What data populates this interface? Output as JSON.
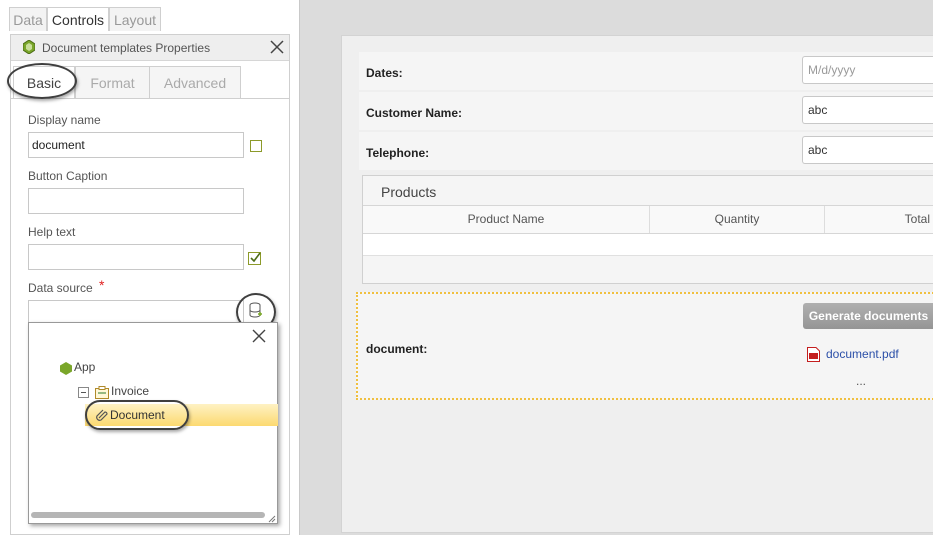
{
  "left_tabs": [
    "Data",
    "Controls",
    "Layout"
  ],
  "properties": {
    "title": "Document templates Properties",
    "sub_tabs": [
      "Basic",
      "Format",
      "Advanced"
    ],
    "display_name_label": "Display name",
    "display_name_value": "document",
    "button_caption_label": "Button Caption",
    "button_caption_value": "",
    "help_text_label": "Help text",
    "help_text_value": "",
    "data_source_label": "Data source",
    "required_mark": "*",
    "data_source_value": ""
  },
  "tree": {
    "root": "App",
    "child": "Invoice",
    "selected": "Document"
  },
  "form": {
    "dates_label": "Dates:",
    "dates_placeholder": "M/d/yyyy",
    "customer_label": "Customer Name:",
    "customer_value": "abc",
    "telephone_label": "Telephone:",
    "telephone_value": "abc",
    "products_title": "Products",
    "columns": [
      "Product Name",
      "Quantity",
      "Total"
    ],
    "document_label": "document:",
    "generate_button": "Generate documents",
    "file_link": "document.pdf",
    "more": "..."
  },
  "colors": {
    "accent_green": "#7aa62a",
    "selection": "#fde79a",
    "button": "#9e9e9e",
    "link": "#2b4fa8"
  }
}
